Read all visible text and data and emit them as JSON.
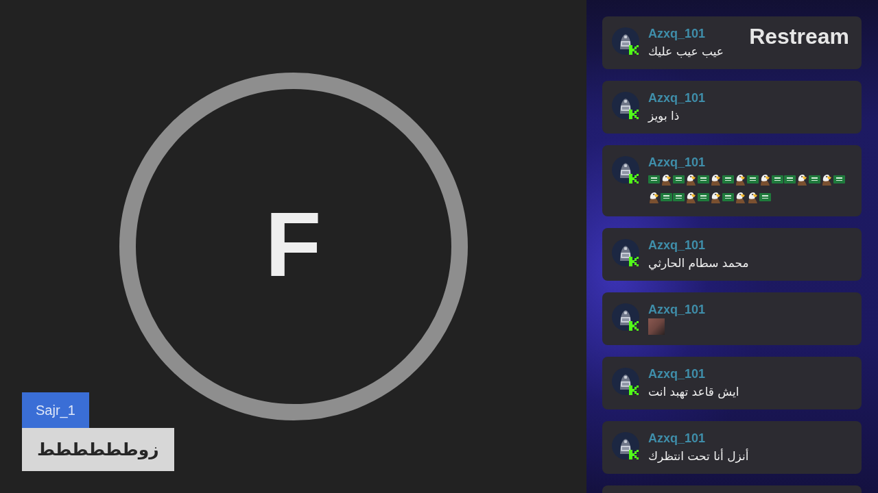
{
  "stage": {
    "initial": "F",
    "name_tag": {
      "name": "Sajr_1",
      "message": "زوطططططط"
    }
  },
  "chat": {
    "branding": "Restream",
    "messages": [
      {
        "author": "Azxq_101",
        "kind": "text",
        "text": "عيب عيب عليك"
      },
      {
        "author": "Azxq_101",
        "kind": "text",
        "text": "ذا بويز"
      },
      {
        "author": "Azxq_101",
        "kind": "emotes",
        "emotes": [
          {
            "kind": "flag"
          },
          {
            "kind": "eagle"
          },
          {
            "kind": "flag"
          },
          {
            "kind": "eagle"
          },
          {
            "kind": "flag"
          },
          {
            "kind": "eagle"
          },
          {
            "kind": "flag"
          },
          {
            "kind": "eagle"
          },
          {
            "kind": "flag"
          },
          {
            "kind": "eagle"
          },
          {
            "kind": "flag"
          },
          {
            "kind": "flag"
          },
          {
            "kind": "eagle"
          },
          {
            "kind": "flag"
          },
          {
            "kind": "eagle"
          },
          {
            "kind": "flag"
          },
          {
            "kind": "eagle"
          },
          {
            "kind": "flag"
          },
          {
            "kind": "flag"
          },
          {
            "kind": "eagle"
          },
          {
            "kind": "flag"
          },
          {
            "kind": "eagle"
          },
          {
            "kind": "flag"
          },
          {
            "kind": "eagle"
          },
          {
            "kind": "eagle"
          },
          {
            "kind": "flag"
          }
        ]
      },
      {
        "author": "Azxq_101",
        "kind": "text",
        "text": "محمد سطام الحارثي"
      },
      {
        "author": "Azxq_101",
        "kind": "image"
      },
      {
        "author": "Azxq_101",
        "kind": "text",
        "text": "ايش قاعد تهبد انت"
      },
      {
        "author": "Azxq_101",
        "kind": "text",
        "text": "أنزل أنا تحت انتظرك"
      }
    ],
    "cut_off_card": true
  }
}
